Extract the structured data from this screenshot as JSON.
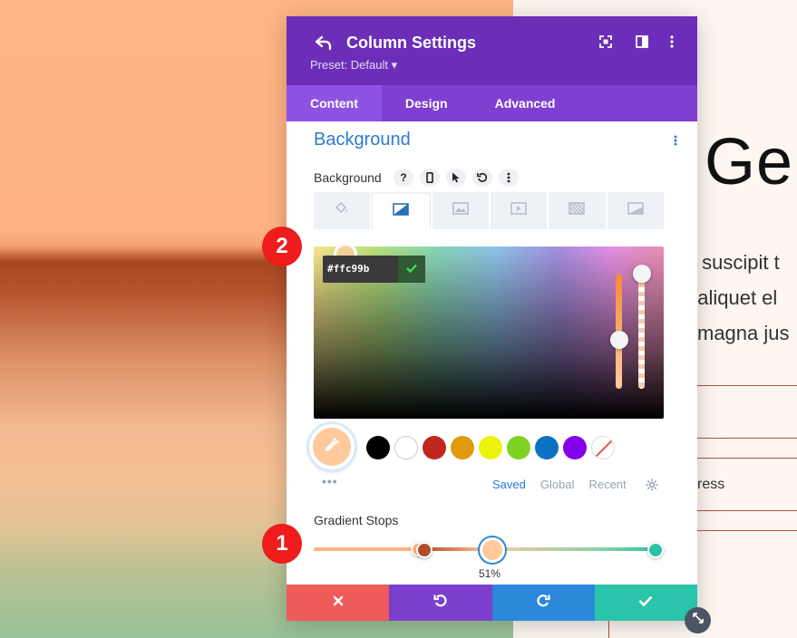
{
  "page": {
    "heading": "Ge",
    "line1": "s suscipit t",
    "line2": "t aliquet el",
    "line3": "magna jus",
    "word": "ress"
  },
  "modal": {
    "title": "Column Settings",
    "preset": "Preset: Default ▾",
    "tabs": [
      "Content",
      "Design",
      "Advanced"
    ],
    "active_tab": "Content",
    "section_title": "Background",
    "field_label": "Background",
    "help_glyph": "?",
    "background_types": [
      "color",
      "gradient",
      "image",
      "video",
      "pattern",
      "mask"
    ],
    "active_background_type": "gradient",
    "color_picker": {
      "hex_value": "#ffc99b",
      "selected_color": "#ffc99b"
    },
    "swatches": [
      "#000000",
      "#ffffff",
      "#c0281e",
      "#e09a0c",
      "#eef20c",
      "#7ed321",
      "#0c71c3",
      "#8300e9",
      "none"
    ],
    "palette_tabs": [
      "Saved",
      "Global",
      "Recent"
    ],
    "active_palette_tab": "Saved",
    "more_glyph": "•••",
    "gradient_stops_label": "Gradient Stops",
    "gradient_stops": [
      {
        "color": "#ffb584"
      },
      {
        "color": "#b04e25"
      },
      {
        "color": "#ffc99b",
        "selected": true
      },
      {
        "color": "#2cc2a6"
      }
    ],
    "selected_stop_percent": "51%",
    "footer": {
      "cancel_color": "#ef5a5a",
      "undo_color": "#7b3fce",
      "redo_color": "#2b87da",
      "save_color": "#29c4a9"
    }
  },
  "badges": [
    "2",
    "1"
  ],
  "colors": {
    "header": "#6c2eb9",
    "tabs": "#7f3fd0",
    "accent": "#2c7ad4",
    "badge": "#ee1c1c"
  }
}
